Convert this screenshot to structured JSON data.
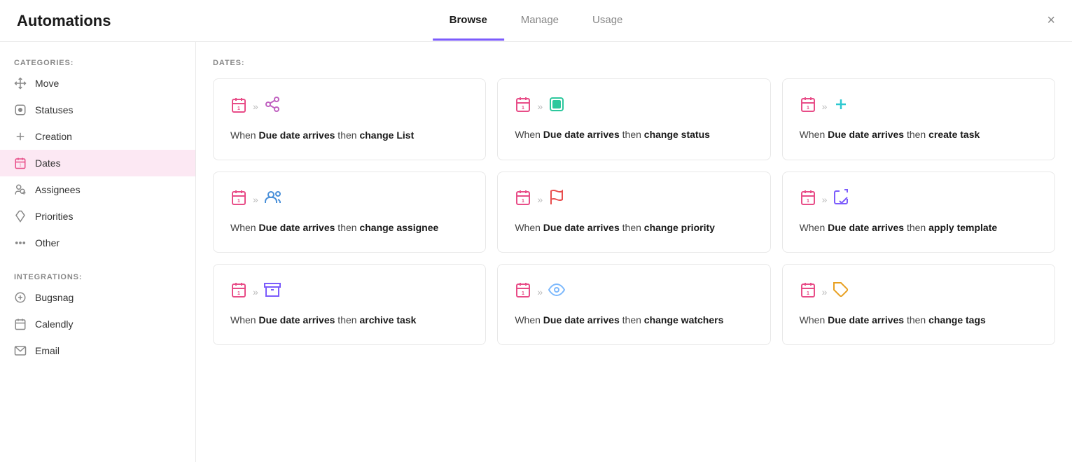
{
  "header": {
    "title": "Automations",
    "tabs": [
      {
        "label": "Browse",
        "active": true
      },
      {
        "label": "Manage",
        "active": false
      },
      {
        "label": "Usage",
        "active": false
      }
    ],
    "close_label": "×"
  },
  "sidebar": {
    "categories_label": "CATEGORIES:",
    "integrations_label": "INTEGRATIONS:",
    "items": [
      {
        "id": "move",
        "label": "Move",
        "icon": "move-icon"
      },
      {
        "id": "statuses",
        "label": "Statuses",
        "icon": "statuses-icon"
      },
      {
        "id": "creation",
        "label": "Creation",
        "icon": "creation-icon"
      },
      {
        "id": "dates",
        "label": "Dates",
        "icon": "dates-icon",
        "active": true
      },
      {
        "id": "assignees",
        "label": "Assignees",
        "icon": "assignees-icon"
      },
      {
        "id": "priorities",
        "label": "Priorities",
        "icon": "priorities-icon"
      },
      {
        "id": "other",
        "label": "Other",
        "icon": "other-icon"
      }
    ],
    "integrations": [
      {
        "id": "bugsnag",
        "label": "Bugsnag",
        "icon": "bugsnag-icon"
      },
      {
        "id": "calendly",
        "label": "Calendly",
        "icon": "calendly-icon"
      },
      {
        "id": "email",
        "label": "Email",
        "icon": "email-icon"
      }
    ]
  },
  "main": {
    "section_label": "DATES:",
    "cards": [
      {
        "id": "card-change-list",
        "text_prefix": "When ",
        "text_trigger": "Due date arrives",
        "text_middle": " then ",
        "text_action": "change List",
        "icon_left": "calendar-icon",
        "icon_right": "share-arrow-icon"
      },
      {
        "id": "card-change-status",
        "text_prefix": "When ",
        "text_trigger": "Due date arrives",
        "text_middle": " then ",
        "text_action": "change status",
        "icon_left": "calendar-icon",
        "icon_right": "status-square-icon"
      },
      {
        "id": "card-create-task",
        "text_prefix": "When ",
        "text_trigger": "Due date arrives",
        "text_middle": " then ",
        "text_action": "create task",
        "icon_left": "calendar-icon",
        "icon_right": "plus-icon"
      },
      {
        "id": "card-change-assignee",
        "text_prefix": "When ",
        "text_trigger": "Due date arrives",
        "text_middle": " then ",
        "text_action": "change assignee",
        "icon_left": "calendar-icon",
        "icon_right": "people-icon"
      },
      {
        "id": "card-change-priority",
        "text_prefix": "When ",
        "text_trigger": "Due date arrives",
        "text_middle": " then ",
        "text_action": "change priority",
        "icon_left": "calendar-icon",
        "icon_right": "flag-icon"
      },
      {
        "id": "card-apply-template",
        "text_prefix": "When ",
        "text_trigger": "Due date arrives",
        "text_middle": " then ",
        "text_action": "apply template",
        "icon_left": "calendar-icon",
        "icon_right": "template-icon"
      },
      {
        "id": "card-archive-task",
        "text_prefix": "When ",
        "text_trigger": "Due date arrives",
        "text_middle": " then ",
        "text_action": "archive task",
        "icon_left": "calendar-icon",
        "icon_right": "archive-icon"
      },
      {
        "id": "card-change-watchers",
        "text_prefix": "When ",
        "text_trigger": "Due date arrives",
        "text_middle": " then ",
        "text_action": "change watchers",
        "icon_left": "calendar-icon",
        "icon_right": "watchers-icon"
      },
      {
        "id": "card-change-tags",
        "text_prefix": "When ",
        "text_trigger": "Due date arrives",
        "text_middle": " then ",
        "text_action": "change tags",
        "icon_left": "calendar-icon",
        "icon_right": "tag-icon"
      }
    ]
  }
}
